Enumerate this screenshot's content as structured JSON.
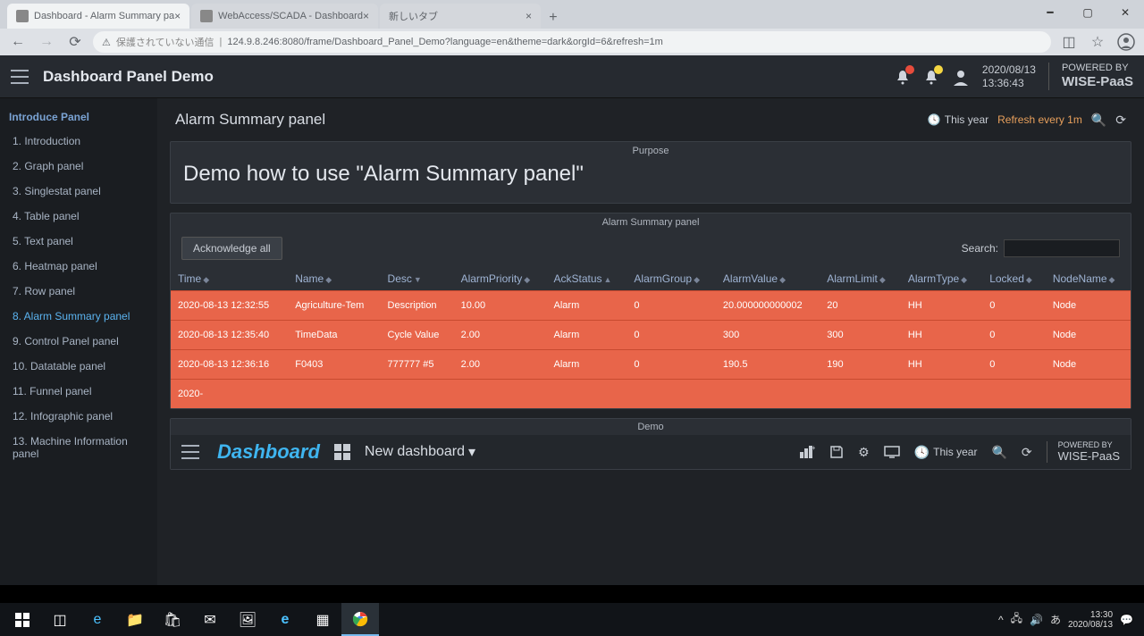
{
  "browser": {
    "tabs": [
      {
        "title": "Dashboard - Alarm Summary pa"
      },
      {
        "title": "WebAccess/SCADA - Dashboard"
      },
      {
        "title": "新しいタブ"
      }
    ],
    "url_warning": "保護されていない通信",
    "url": "124.9.8.246:8080/frame/Dashboard_Panel_Demo?language=en&theme=dark&orgId=6&refresh=1m"
  },
  "header": {
    "title": "Dashboard Panel Demo",
    "date": "2020/08/13",
    "time": "13:36:43",
    "powered_label": "POWERED BY",
    "powered_brand": "WISE-PaaS"
  },
  "sidebar": {
    "heading": "Introduce Panel",
    "items": [
      {
        "label": "1. Introduction"
      },
      {
        "label": "2. Graph panel"
      },
      {
        "label": "3. Singlestat panel"
      },
      {
        "label": "4. Table panel"
      },
      {
        "label": "5. Text panel"
      },
      {
        "label": "6. Heatmap panel"
      },
      {
        "label": "7. Row panel"
      },
      {
        "label": "8. Alarm Summary panel",
        "active": true
      },
      {
        "label": "9. Control Panel panel"
      },
      {
        "label": "10. Datatable panel"
      },
      {
        "label": "11. Funnel panel"
      },
      {
        "label": "12. Infographic panel"
      },
      {
        "label": "13. Machine Information panel"
      }
    ]
  },
  "page": {
    "title": "Alarm Summary panel",
    "time_range": "This year",
    "refresh_text": "Refresh every 1m"
  },
  "purpose": {
    "label": "Purpose",
    "text": "Demo how to use \"Alarm Summary panel\""
  },
  "alarm_panel": {
    "label": "Alarm Summary panel",
    "ack_button": "Acknowledge all",
    "search_label": "Search:",
    "columns": [
      "Time",
      "Name",
      "Desc",
      "AlarmPriority",
      "AckStatus",
      "AlarmGroup",
      "AlarmValue",
      "AlarmLimit",
      "AlarmType",
      "Locked",
      "NodeName"
    ],
    "rows": [
      {
        "time": "2020-08-13 12:32:55",
        "name": "Agriculture-Tem",
        "desc": "Description",
        "priority": "10.00",
        "ack": "Alarm",
        "group": "0",
        "value": "20.000000000002",
        "limit": "20",
        "type": "HH",
        "locked": "0",
        "node": "Node"
      },
      {
        "time": "2020-08-13 12:35:40",
        "name": "TimeData",
        "desc": "Cycle Value",
        "priority": "2.00",
        "ack": "Alarm",
        "group": "0",
        "value": "300",
        "limit": "300",
        "type": "HH",
        "locked": "0",
        "node": "Node"
      },
      {
        "time": "2020-08-13 12:36:16",
        "name": "F0403",
        "desc": "777777 #5",
        "priority": "2.00",
        "ack": "Alarm",
        "group": "0",
        "value": "190.5",
        "limit": "190",
        "type": "HH",
        "locked": "0",
        "node": "Node"
      },
      {
        "time": "2020-",
        "name": "",
        "desc": "",
        "priority": "",
        "ack": "",
        "group": "",
        "value": "",
        "limit": "",
        "type": "",
        "locked": "",
        "node": ""
      }
    ]
  },
  "demo_panel": {
    "label": "Demo",
    "brand": "Dashboard",
    "dash_name": "New dashboard",
    "time_range": "This year",
    "powered_label": "POWERED BY",
    "powered_brand": "WISE-PaaS"
  },
  "taskbar": {
    "time": "13:30",
    "date": "2020/08/13"
  }
}
